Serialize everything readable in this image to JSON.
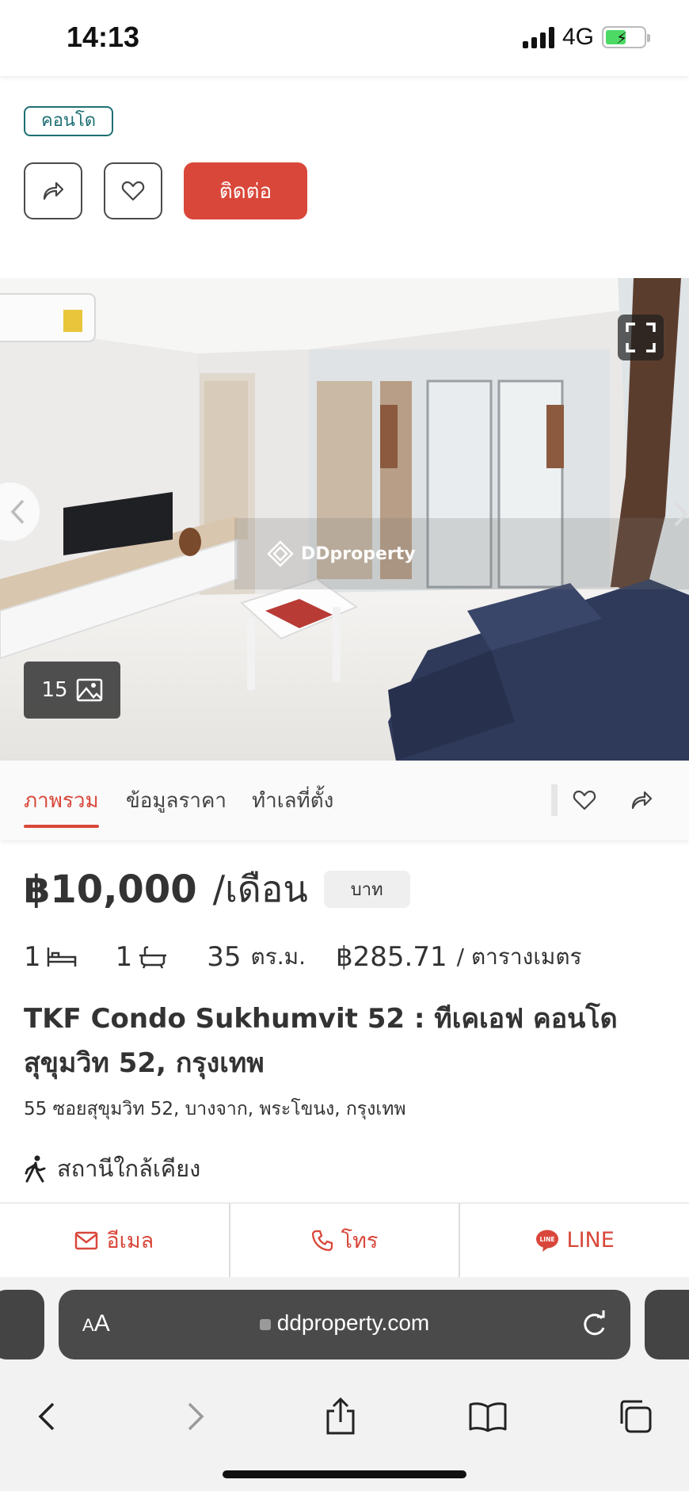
{
  "status_bar": {
    "time": "14:13",
    "network": "4G"
  },
  "listing": {
    "property_type_tag": "คอนโด",
    "contact_label": "ติดต่อ",
    "photo_count": "15",
    "watermark": "DDproperty"
  },
  "tabs": [
    {
      "label": "ภาพรวม",
      "active": true
    },
    {
      "label": "ข้อมูลราคา",
      "active": false
    },
    {
      "label": "ทำเลที่ตั้ง",
      "active": false
    }
  ],
  "details": {
    "price": "฿10,000",
    "price_unit": "/เดือน",
    "currency": "บาท",
    "bedrooms": "1",
    "bathrooms": "1",
    "area_value": "35",
    "area_unit": "ตร.ม.",
    "price_per_sqm": "฿285.71",
    "price_per_sqm_unit": "/ ตารางเมตร",
    "title": "TKF Condo Sukhumvit 52 : ทีเคเอฟ คอนโด สุขุมวิท 52, กรุงเทพ",
    "address": "55 ซอยสุขุมวิท 52, บางจาก, พระโขนง, กรุงเทพ",
    "nearby_label": "สถานีใกล้เคียง"
  },
  "actions": {
    "email": "อีเมล",
    "call": "โทร",
    "line": "LINE",
    "line_badge": "LINE"
  },
  "browser": {
    "aa_label": "AA",
    "url": "ddproperty.com"
  },
  "colors": {
    "accent": "#d9473a",
    "tag": "#1e6f73"
  }
}
